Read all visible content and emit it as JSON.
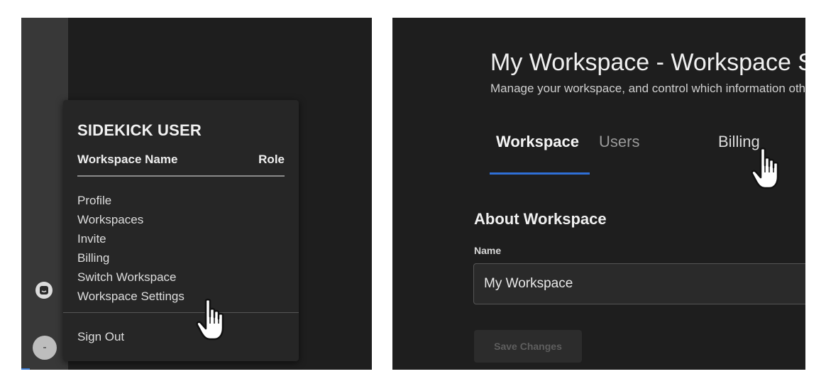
{
  "left_panel": {
    "avatar_initial": "-",
    "menu": {
      "user_name": "SIDEKICK USER",
      "workspace_col": "Workspace Name",
      "role_col": "Role",
      "items": [
        {
          "label": "Profile"
        },
        {
          "label": "Workspaces"
        },
        {
          "label": "Invite"
        },
        {
          "label": "Billing"
        },
        {
          "label": "Switch Workspace"
        },
        {
          "label": "Workspace Settings"
        }
      ],
      "sign_out": "Sign Out"
    }
  },
  "right_panel": {
    "title": "My Workspace - Workspace Settings",
    "subtitle": "Manage your workspace, and control which information other members can see.",
    "tabs": [
      {
        "label": "Workspace",
        "active": true
      },
      {
        "label": "Users",
        "active": false
      },
      {
        "label": "Billing",
        "active": false
      }
    ],
    "section_title": "About Workspace",
    "name_label": "Name",
    "name_value": "My Workspace",
    "save_label": "Save Changes"
  },
  "colors": {
    "panel_bg": "#1e1e1e",
    "rail_bg": "#383838",
    "accent": "#2f6fd6"
  },
  "icons": [
    "chat-icon",
    "hand-pointer-icon"
  ]
}
